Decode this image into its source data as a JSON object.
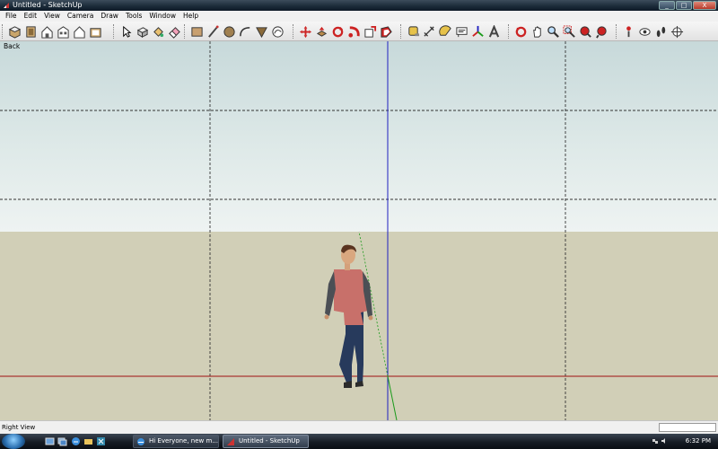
{
  "window": {
    "title": "Untitled - SketchUp",
    "buttons": {
      "minimize": "_",
      "maximize": "□",
      "close": "X"
    }
  },
  "menu": [
    "File",
    "Edit",
    "View",
    "Camera",
    "Draw",
    "Tools",
    "Window",
    "Help"
  ],
  "toolbar": {
    "views": [
      "iso-view-icon",
      "top-view-icon",
      "front-view-icon",
      "right-view-icon",
      "back-view-icon",
      "left-view-icon"
    ],
    "tools": [
      "select-icon",
      "make-component-icon",
      "paint-bucket-icon",
      "eraser-icon",
      "rectangle-icon",
      "line-icon",
      "circle-icon",
      "arc-icon",
      "polygon-icon",
      "freehand-icon",
      "move-icon",
      "push-pull-icon",
      "rotate-icon",
      "follow-me-icon",
      "scale-icon",
      "offset-icon",
      "tape-measure-icon",
      "dimension-icon",
      "protractor-icon",
      "text-icon",
      "axes-icon",
      "3d-text-icon",
      "orbit-icon",
      "pan-icon",
      "zoom-icon",
      "zoom-window-icon",
      "zoom-extents-icon",
      "previous-view-icon",
      "position-camera-icon",
      "look-around-icon",
      "walk-icon",
      "section-plane-icon"
    ]
  },
  "viewport": {
    "scene_label": "Back",
    "colors": {
      "sky_top": "#c7d9da",
      "ground": "#d1cfb7",
      "red_axis": "#a01010",
      "green_axis": "#1a9a1a",
      "blue_axis": "#2020c0"
    }
  },
  "status": {
    "text": "Right View"
  },
  "taskbar": {
    "buttons": [
      "Hi Everyone, new m...",
      "Untitled - SketchUp"
    ],
    "clock": "6:32 PM"
  }
}
